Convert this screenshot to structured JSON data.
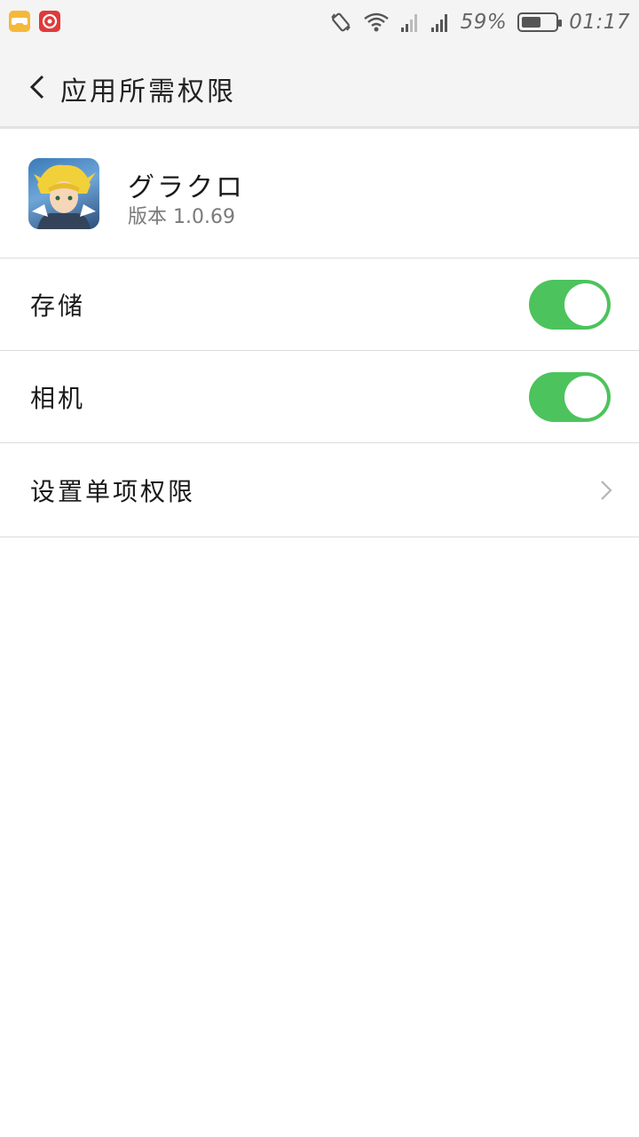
{
  "status_bar": {
    "battery_percent_text": "59%",
    "battery_level": 0.59,
    "time": "01:17",
    "icons": [
      "game-icon",
      "music-icon",
      "rotate-icon",
      "wifi-icon",
      "signal-icon",
      "signal-icon",
      "battery-icon"
    ]
  },
  "header": {
    "title": "应用所需权限",
    "back_icon": "chevron-left-icon"
  },
  "app": {
    "name": "グラクロ",
    "version": "版本 1.0.69"
  },
  "permissions": [
    {
      "label": "存储",
      "enabled": true
    },
    {
      "label": "相机",
      "enabled": true
    }
  ],
  "single_permission": {
    "label": "设置单项权限",
    "icon": "chevron-right-icon"
  },
  "colors": {
    "toggle_on": "#4cc35c",
    "header_bg": "#f4f4f4",
    "divider": "#dcdcdc"
  }
}
